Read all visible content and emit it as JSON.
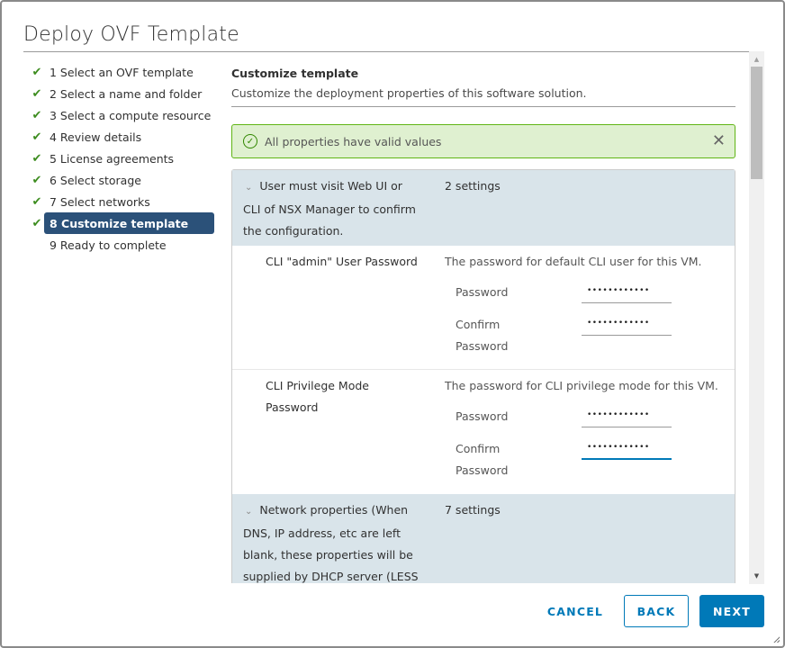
{
  "dialog": {
    "title": "Deploy OVF Template"
  },
  "steps": [
    {
      "label": "1 Select an OVF template",
      "completed": true,
      "active": false
    },
    {
      "label": "2 Select a name and folder",
      "completed": true,
      "active": false
    },
    {
      "label": "3 Select a compute resource",
      "completed": true,
      "active": false
    },
    {
      "label": "4 Review details",
      "completed": true,
      "active": false
    },
    {
      "label": "5 License agreements",
      "completed": true,
      "active": false
    },
    {
      "label": "6 Select storage",
      "completed": true,
      "active": false
    },
    {
      "label": "7 Select networks",
      "completed": true,
      "active": false
    },
    {
      "label": "8 Customize template",
      "completed": true,
      "active": true
    },
    {
      "label": "9 Ready to complete",
      "completed": false,
      "active": false
    }
  ],
  "content": {
    "title": "Customize template",
    "subtitle": "Customize the deployment properties of this software solution.",
    "alert": {
      "text": "All properties have valid values",
      "type": "success"
    },
    "groups": [
      {
        "name_lines": [
          "User must visit Web UI or",
          "CLI of NSX Manager to confirm",
          "the configuration."
        ],
        "count": "2 settings",
        "properties": [
          {
            "name_lines": [
              "CLI \"admin\" User Password"
            ],
            "description": "The password for default CLI user for this VM.",
            "password_label": "Password",
            "password_value": "••••••••••••",
            "confirm_label_lines": [
              "Confirm",
              "Password"
            ],
            "confirm_value": "••••••••••••"
          },
          {
            "name_lines": [
              "CLI Privilege Mode",
              "Password"
            ],
            "description": "The password for CLI privilege mode for this VM.",
            "password_label": "Password",
            "password_value": "••••••••••••",
            "confirm_label_lines": [
              "Confirm",
              "Password"
            ],
            "confirm_value": "••••••••••••"
          }
        ]
      },
      {
        "name_lines": [
          "Network properties (When",
          "DNS, IP address, etc are left",
          "blank, these properties will be",
          "supplied by DHCP server (LESS"
        ],
        "count": "7 settings"
      }
    ]
  },
  "icons": {
    "check": "✔",
    "chevron": "⌄",
    "close": "✕",
    "ok": "✓",
    "scroll_up": "▲",
    "scroll_down": "▼"
  },
  "buttons": {
    "cancel": "CANCEL",
    "back": "BACK",
    "next": "NEXT"
  }
}
